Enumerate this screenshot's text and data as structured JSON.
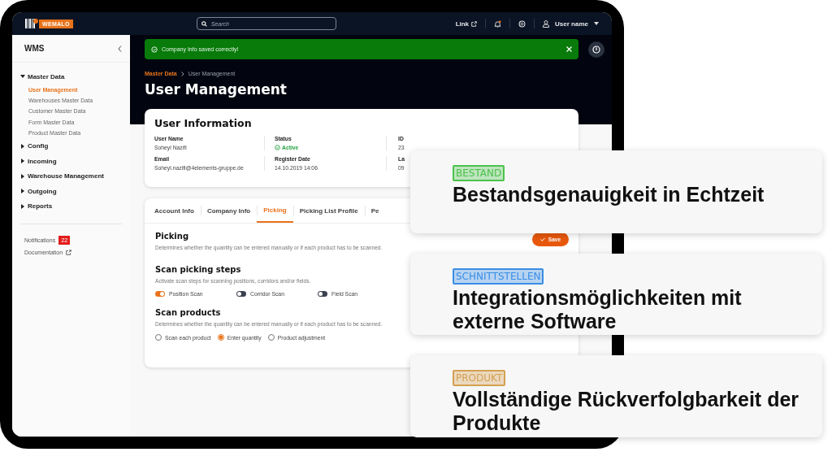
{
  "top_bar": {
    "logo": "WEMALO",
    "search": {
      "placeholder": "Search"
    },
    "link": "Link",
    "user": "User name"
  },
  "sidebar": {
    "title": "WMS",
    "nav": [
      {
        "label": "Master Data",
        "expanded": true,
        "children": [
          {
            "label": "User Management",
            "selected": true
          },
          {
            "label": "Warehouses Master Data",
            "selected": false
          },
          {
            "label": "Customer Master Data",
            "selected": false
          },
          {
            "label": "Form Master Data",
            "selected": false
          },
          {
            "label": "Product Master Data",
            "selected": false
          }
        ]
      },
      {
        "label": "Config",
        "expanded": false
      },
      {
        "label": "Incoming",
        "expanded": false
      },
      {
        "label": "Warehouse Management",
        "expanded": false
      },
      {
        "label": "Outgoing",
        "expanded": false
      },
      {
        "label": "Reports",
        "expanded": false
      }
    ],
    "footer": [
      {
        "kind": "badge",
        "label": "Notifications",
        "badge": "22"
      },
      {
        "kind": "external",
        "label": "Documentation"
      }
    ]
  },
  "notification": {
    "message": "Company Info saved correctly!"
  },
  "breadcrumb": [
    "Master Data",
    "User Management"
  ],
  "page_title": "User Management",
  "user_info": {
    "title": "User Information",
    "fields": [
      {
        "kind": "text",
        "label": "User Name",
        "value": "Soheyl Nazifi"
      },
      {
        "kind": "text",
        "label": "Email",
        "value": "Soheyl.nazifi@4elements-gruppe.de"
      },
      {
        "kind": "status",
        "label": "Status",
        "value": "Active"
      },
      {
        "kind": "text",
        "label": "Register Date",
        "value": "14.10.2019 14:06"
      },
      {
        "kind": "text",
        "label": "ID",
        "value": "23"
      },
      {
        "kind": "text",
        "label": "La",
        "value": "09"
      }
    ]
  },
  "tabs": [
    {
      "label": "Account Info",
      "selected": false
    },
    {
      "label": "Company Info",
      "selected": false
    },
    {
      "label": "Picking",
      "selected": true
    },
    {
      "label": "Picking List Profile",
      "selected": false
    },
    {
      "label": "Pe",
      "selected": false
    }
  ],
  "picking": {
    "title": "Picking",
    "description": "Determines whether the quantity can be entered manually or if each product has to be scanned.",
    "save": "Save",
    "scan_steps": {
      "title": "Scan picking steps",
      "description": "Activate scan steps for scanning positions, corridors and/or fields.",
      "toggles": [
        {
          "label": "Position Scan",
          "on": true
        },
        {
          "label": "Corridor Scan",
          "on": false
        },
        {
          "label": "Field Scan",
          "on": false
        }
      ]
    },
    "scan_products": {
      "title": "Scan products",
      "description": "Determines whether the quantity can be entered manually or if each product has to be scanned.",
      "options": [
        {
          "label": "Scan each product",
          "selected": false
        },
        {
          "label": "Enter quantity",
          "selected": true
        },
        {
          "label": "Product adjustment",
          "selected": false
        }
      ]
    }
  },
  "feature_cards": [
    {
      "tag": "BESTAND",
      "color": "#4cc24c",
      "title": "Bestandsgenauigkeit in Echtzeit"
    },
    {
      "tag": "SCHNITTSTELLEN",
      "color": "#3a8ee6",
      "title": "Integrationsmöglichkeiten mit externe Software"
    },
    {
      "tag": "PRODUKT",
      "color": "#d4a052",
      "title": "Vollständige Rückverfolgbarkeit der Produkte"
    }
  ]
}
